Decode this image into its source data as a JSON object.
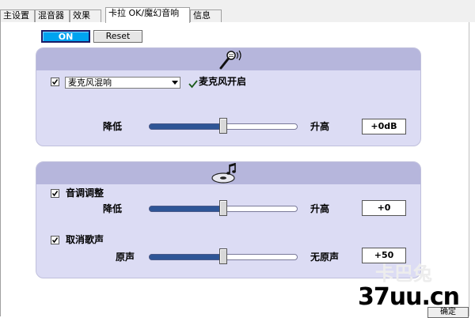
{
  "tabs": [
    {
      "label": "主设置"
    },
    {
      "label": "混音器"
    },
    {
      "label": "效果"
    },
    {
      "label": "卡拉 OK/魔幻音响"
    },
    {
      "label": "信息"
    }
  ],
  "buttons": {
    "on": "ON",
    "reset": "Reset",
    "confirm": "确定"
  },
  "mic_section": {
    "icon": "microphone-icon",
    "checkbox_checked": true,
    "select_value": "麦克风混响",
    "status_text": "麦克风开启",
    "slider": {
      "left_label": "降低",
      "right_label": "升高",
      "value": "+0dB",
      "position": 0.5
    }
  },
  "music_section": {
    "icon": "music-disc-icon",
    "pitch": {
      "checkbox_checked": true,
      "label": "音调调整",
      "left_label": "降低",
      "right_label": "升高",
      "value": "+0",
      "position": 0.5
    },
    "vocal": {
      "checkbox_checked": true,
      "label": "取消歌声",
      "left_label": "原声",
      "right_label": "无原声",
      "value": "+50",
      "position": 0.5
    }
  },
  "watermark": {
    "text": "37uu.cn",
    "faint": "卡巴兔"
  },
  "colors": {
    "accent_on": "#00a3f0",
    "group_bg": "#dcdcf4",
    "group_header": "#b6b6dc",
    "slider_fill": "#2e5596"
  }
}
